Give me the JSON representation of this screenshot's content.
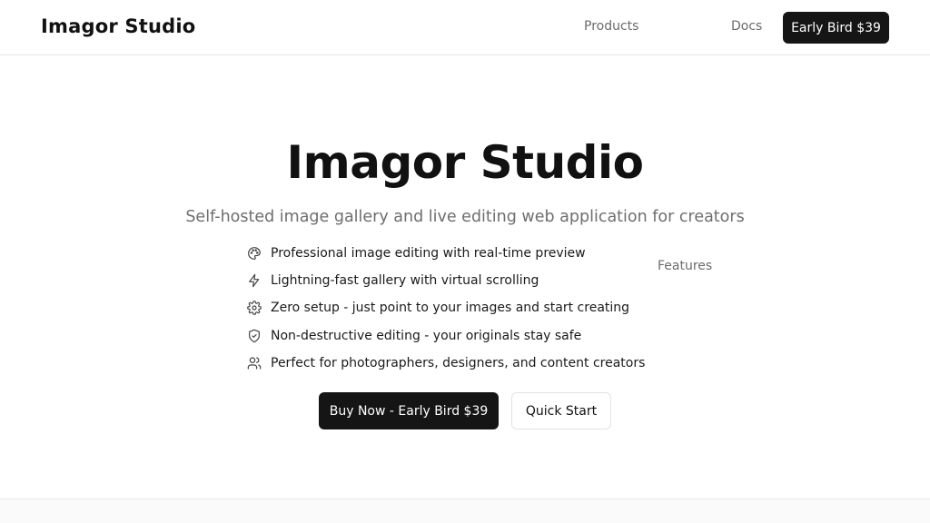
{
  "brand": {
    "name": "Imagor Studio"
  },
  "nav": {
    "links": [
      {
        "label": "Products"
      },
      {
        "label": "Features"
      },
      {
        "label": "Docs"
      }
    ],
    "cta_label": "Early Bird $39"
  },
  "hero": {
    "title": "Imagor Studio",
    "subtitle": "Self-hosted image gallery and live editing web application for creators",
    "features": [
      {
        "icon": "palette-icon",
        "text": "Professional image editing with real-time preview"
      },
      {
        "icon": "lightning-icon",
        "text": "Lightning-fast gallery with virtual scrolling"
      },
      {
        "icon": "gear-icon",
        "text": "Zero setup - just point to your images and start creating"
      },
      {
        "icon": "shield-check-icon",
        "text": "Non-destructive editing - your originals stay safe"
      },
      {
        "icon": "users-icon",
        "text": "Perfect for photographers, designers, and content creators"
      }
    ],
    "primary_button": "Buy Now - Early Bird $39",
    "secondary_button": "Quick Start"
  },
  "colors": {
    "primary": "#151515",
    "text_muted": "#6b6b6b",
    "border": "#e6e6e6"
  }
}
